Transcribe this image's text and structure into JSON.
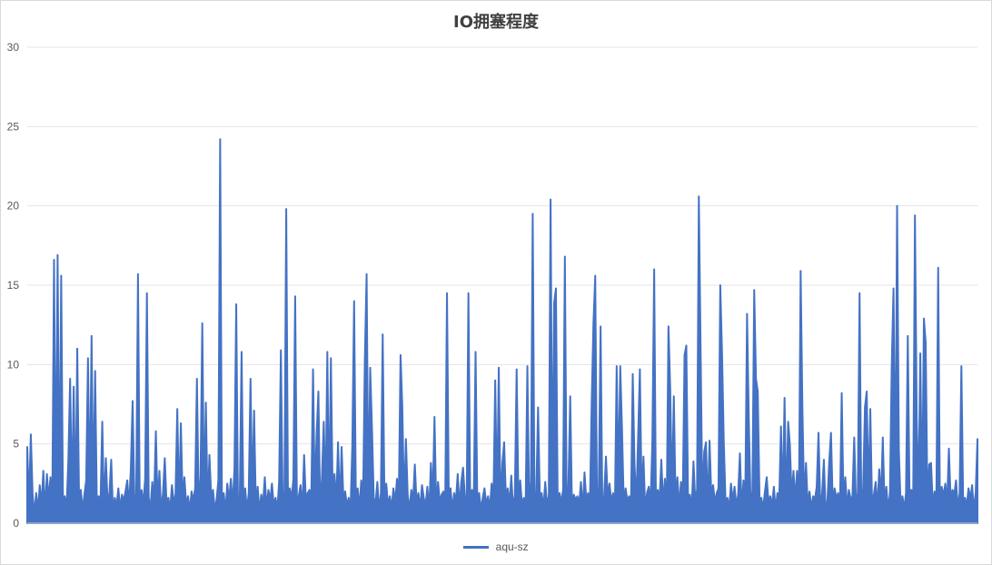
{
  "chart_data": {
    "type": "line",
    "title": "IO拥塞程度",
    "xlabel": "",
    "ylabel": "",
    "ylim": [
      0,
      30
    ],
    "yticks": [
      0,
      5,
      10,
      15,
      20,
      25,
      30
    ],
    "grid": true,
    "legend_position": "bottom",
    "color": "#4472c4",
    "series": [
      {
        "name": "aqu-sz",
        "values": [
          4.8,
          1.2,
          5.6,
          1.8,
          0.6,
          1.9,
          0.8,
          2.4,
          1.1,
          3.3,
          0.7,
          3.1,
          1.5,
          2.9,
          0.9,
          16.6,
          1.3,
          16.9,
          0.8,
          15.6,
          1.2,
          1.7,
          0.9,
          3.9,
          9.1,
          1.4,
          8.6,
          0.7,
          11.0,
          1.6,
          2.1,
          0.8,
          1.8,
          2.7,
          10.4,
          1.1,
          11.8,
          1.5,
          9.6,
          0.9,
          1.7,
          1.2,
          6.4,
          0.8,
          4.1,
          1.3,
          1.9,
          4.0,
          0.7,
          1.6,
          1.1,
          2.2,
          0.9,
          1.8,
          1.4,
          2.0,
          2.7,
          1.0,
          3.5,
          7.7,
          1.3,
          1.8,
          15.7,
          0.8,
          2.1,
          1.2,
          2.8,
          14.5,
          1.6,
          0.9,
          2.6,
          1.4,
          5.8,
          1.1,
          3.3,
          0.7,
          1.9,
          4.1,
          1.2,
          1.6,
          0.8,
          2.4,
          1.3,
          1.8,
          7.2,
          0.9,
          6.3,
          1.5,
          2.9,
          1.1,
          1.7,
          0.8,
          2.0,
          1.4,
          2.2,
          9.1,
          1.0,
          2.9,
          12.6,
          1.3,
          7.6,
          0.9,
          4.3,
          1.6,
          2.1,
          0.8,
          1.5,
          2.7,
          24.2,
          1.2,
          1.9,
          0.7,
          2.5,
          1.4,
          2.8,
          1.1,
          3.4,
          13.8,
          0.9,
          1.7,
          10.8,
          1.3,
          2.2,
          0.8,
          1.9,
          9.1,
          1.5,
          7.1,
          1.0,
          2.3,
          0.7,
          1.8,
          1.2,
          2.9,
          0.9,
          2.1,
          1.4,
          2.5,
          1.1,
          1.6,
          0.8,
          2.6,
          10.9,
          1.3,
          1.9,
          19.8,
          0.9,
          2.2,
          1.5,
          2.8,
          14.3,
          1.1,
          1.7,
          2.4,
          0.8,
          4.3,
          1.4,
          1.9,
          2.1,
          1.2,
          9.7,
          1.6,
          5.6,
          8.3,
          0.9,
          2.9,
          6.4,
          1.3,
          10.8,
          0.7,
          10.4,
          1.8,
          3.1,
          1.2,
          5.1,
          0.9,
          4.8,
          1.5,
          2.0,
          1.1,
          1.6,
          0.8,
          4.9,
          14.0,
          1.4,
          2.2,
          0.9,
          2.7,
          1.3,
          10.3,
          15.7,
          1.0,
          9.8,
          6.0,
          1.6,
          1.2,
          2.6,
          0.8,
          1.9,
          11.9,
          1.4,
          2.5,
          1.1,
          1.7,
          0.9,
          2.2,
          1.3,
          2.8,
          1.5,
          10.6,
          7.3,
          1.0,
          5.3,
          1.8,
          0.8,
          2.1,
          1.4,
          3.7,
          1.2,
          1.9,
          0.9,
          2.4,
          1.6,
          1.1,
          2.3,
          0.7,
          3.8,
          1.5,
          6.7,
          0.9,
          2.6,
          1.3,
          1.8,
          2.0,
          1.1,
          14.5,
          1.6,
          2.2,
          0.8,
          1.9,
          1.4,
          3.1,
          1.0,
          2.6,
          3.5,
          1.7,
          0.9,
          14.5,
          1.3,
          2.1,
          1.5,
          10.8,
          1.1,
          1.9,
          0.8,
          1.6,
          2.2,
          1.2,
          1.7,
          0.9,
          2.5,
          1.4,
          9.0,
          1.1,
          9.8,
          0.8,
          3.8,
          5.1,
          1.5,
          2.2,
          1.2,
          3.0,
          0.9,
          1.8,
          9.7,
          1.4,
          2.7,
          1.1,
          1.6,
          0.8,
          9.9,
          1.3,
          2.6,
          19.5,
          1.0,
          2.0,
          7.3,
          1.5,
          1.9,
          0.9,
          2.6,
          1.2,
          1.7,
          20.4,
          1.4,
          13.9,
          14.8,
          0.8,
          1.9,
          1.3,
          2.1,
          16.8,
          1.1,
          2.4,
          8.0,
          0.9,
          1.8,
          1.5,
          1.7,
          1.2,
          2.6,
          0.8,
          3.2,
          1.4,
          1.9,
          1.0,
          7.5,
          12.6,
          15.6,
          1.1,
          2.2,
          12.4,
          0.9,
          1.7,
          4.2,
          1.6,
          2.5,
          1.3,
          1.9,
          0.8,
          9.9,
          2.4,
          9.9,
          5.9,
          1.1,
          2.2,
          1.4,
          1.7,
          0.9,
          9.4,
          3.7,
          1.2,
          5.4,
          9.7,
          1.5,
          4.2,
          0.8,
          1.9,
          2.3,
          1.1,
          5.3,
          16.0,
          0.9,
          2.1,
          1.4,
          4.0,
          1.2,
          2.8,
          0.8,
          12.4,
          8.4,
          1.6,
          8.0,
          1.3,
          2.9,
          1.0,
          2.6,
          1.5,
          10.6,
          11.2,
          1.2,
          1.8,
          0.9,
          3.9,
          1.4,
          2.1,
          20.6,
          11.0,
          1.1,
          4.5,
          5.1,
          0.8,
          5.2,
          1.7,
          2.4,
          1.3,
          1.9,
          2.2,
          15.0,
          10.7,
          5.0,
          1.2,
          1.6,
          0.9,
          2.5,
          1.4,
          2.3,
          1.1,
          1.8,
          4.4,
          0.8,
          2.7,
          1.5,
          13.2,
          6.4,
          1.2,
          2.0,
          14.7,
          9.1,
          8.3,
          1.4,
          1.6,
          0.9,
          2.0,
          2.9,
          1.3,
          1.7,
          1.1,
          2.3,
          0.8,
          1.9,
          1.5,
          6.1,
          1.2,
          7.9,
          0.9,
          6.4,
          4.9,
          1.6,
          3.3,
          1.4,
          3.3,
          0.8,
          15.9,
          7.2,
          1.3,
          3.8,
          1.1,
          2.0,
          0.9,
          1.7,
          1.5,
          2.3,
          5.7,
          1.2,
          1.8,
          4.0,
          0.8,
          1.4,
          3.9,
          5.7,
          1.1,
          2.2,
          1.6,
          1.9,
          0.9,
          8.2,
          1.3,
          2.9,
          1.0,
          2.1,
          1.5,
          1.7,
          5.4,
          1.2,
          1.9,
          14.5,
          0.8,
          2.2,
          7.3,
          8.3,
          1.4,
          7.2,
          1.1,
          1.8,
          2.6,
          0.9,
          3.4,
          1.5,
          5.4,
          1.2,
          2.3,
          0.8,
          1.9,
          9.9,
          14.8,
          1.3,
          20.0,
          4.6,
          1.1,
          1.7,
          0.9,
          1.9,
          11.8,
          1.4,
          2.1,
          1.2,
          19.4,
          6.6,
          1.6,
          10.7,
          0.8,
          12.9,
          11.4,
          1.3,
          3.7,
          3.8,
          1.1,
          2.0,
          1.5,
          16.1,
          0.9,
          2.3,
          1.7,
          2.5,
          1.2,
          4.7,
          1.4,
          2.1,
          1.8,
          2.7,
          0.9,
          1.9,
          9.9,
          1.3,
          1.6,
          1.1,
          2.2,
          1.5,
          2.4,
          0.8,
          1.9,
          5.3
        ]
      }
    ]
  }
}
